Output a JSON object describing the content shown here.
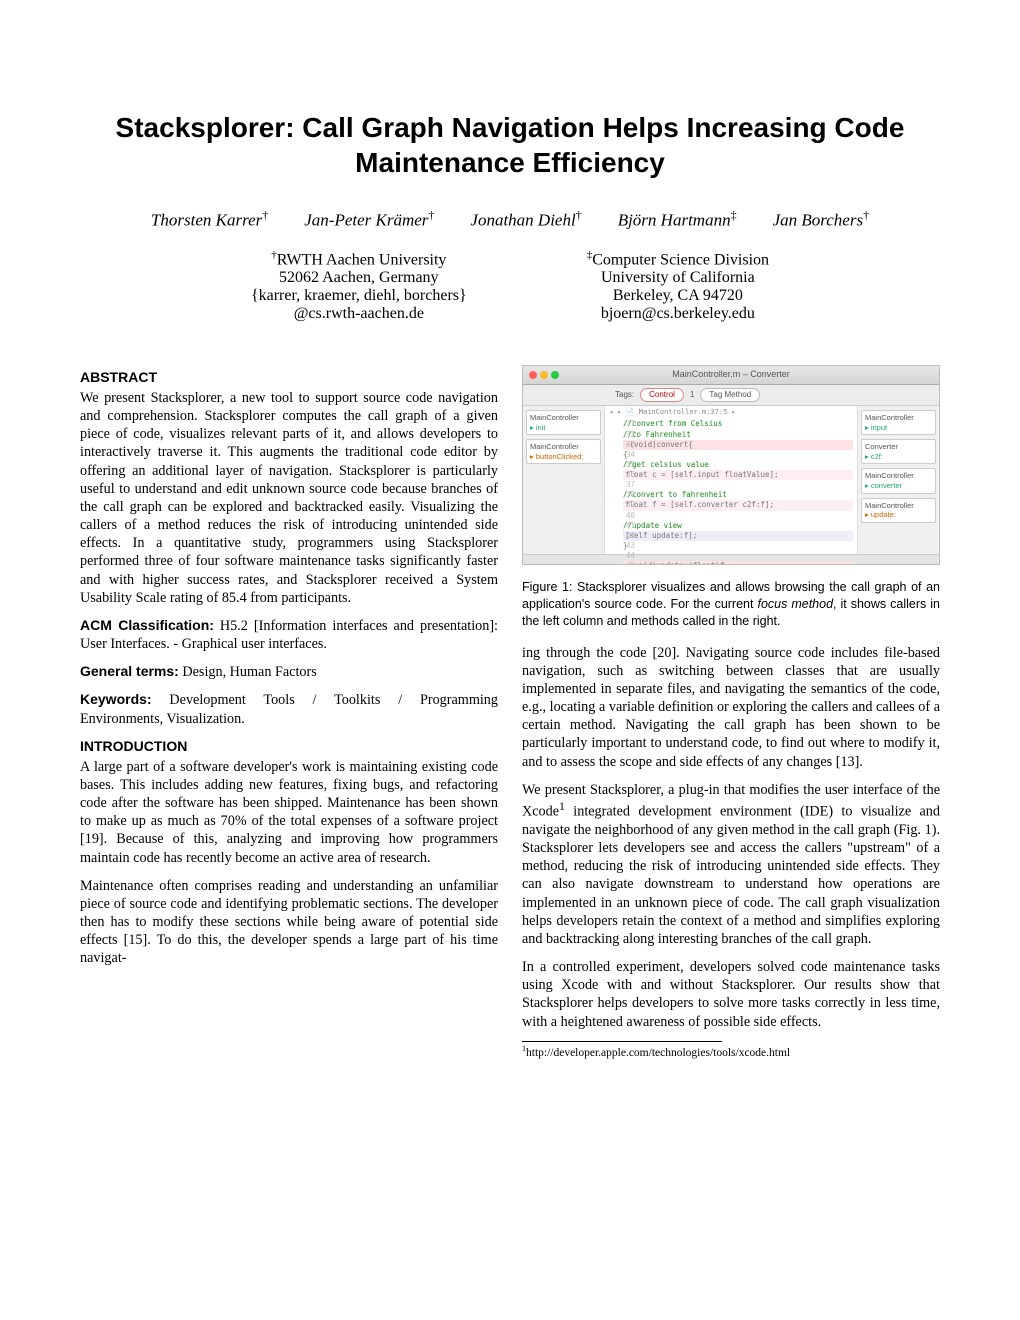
{
  "title": "Stacksplorer: Call Graph Navigation Helps Increasing Code Maintenance Efficiency",
  "authors": [
    {
      "name": "Thorsten Karrer",
      "mark": "†"
    },
    {
      "name": "Jan-Peter Krämer",
      "mark": "†"
    },
    {
      "name": "Jonathan Diehl",
      "mark": "†"
    },
    {
      "name": "Björn Hartmann",
      "mark": "‡"
    },
    {
      "name": "Jan Borchers",
      "mark": "†"
    }
  ],
  "affiliations": {
    "left": {
      "mark": "†",
      "lines": [
        "RWTH Aachen University",
        "52062 Aachen, Germany",
        "{karrer, kraemer, diehl, borchers}",
        "@cs.rwth-aachen.de"
      ]
    },
    "right": {
      "mark": "‡",
      "lines": [
        "Computer Science Division",
        "University of California",
        "Berkeley, CA 94720",
        "bjoern@cs.berkeley.edu"
      ]
    }
  },
  "left_column": {
    "abstract_head": "ABSTRACT",
    "abstract": "We present Stacksplorer, a new tool to support source code navigation and comprehension. Stacksplorer computes the call graph of a given piece of code, visualizes relevant parts of it, and allows developers to interactively traverse it. This augments the traditional code editor by offering an additional layer of navigation. Stacksplorer is particularly useful to understand and edit unknown source code because branches of the call graph can be explored and backtracked easily. Visualizing the callers of a method reduces the risk of introducing unintended side effects. In a quantitative study, programmers using Stacksplorer performed three of four software maintenance tasks significantly faster and with higher success rates, and Stacksplorer received a System Usability Scale rating of 85.4 from participants.",
    "acm_head": "ACM Classification:",
    "acm_text": " H5.2 [Information interfaces and presentation]: User Interfaces. - Graphical user interfaces.",
    "general_head": "General terms:",
    "general_text": " Design, Human Factors",
    "keywords_head": "Keywords:",
    "keywords_text": " Development Tools / Toolkits / Programming Environments, Visualization.",
    "intro_head": "INTRODUCTION",
    "intro_p1": "A large part of a software developer's work is maintaining existing code bases. This includes adding new features, fixing bugs, and refactoring code after the software has been shipped. Maintenance has been shown to make up as much as 70% of the total expenses of a software project [19]. Because of this, analyzing and improving how programmers maintain code has recently become an active area of research.",
    "intro_p2": "Maintenance often comprises reading and understanding an unfamiliar piece of source code and identifying problematic sections. The developer then has to modify these sections while being aware of potential side effects [15]. To do this, the developer spends a large part of his time navigat-"
  },
  "figure": {
    "window_title": "MainController.m – Converter",
    "tags_label": "Tags:",
    "tag_control": "Control",
    "tag_method_btn": "Tag Method",
    "path_crumb": "MainController.m:37:5",
    "left_nodes": [
      {
        "cls": "MainController",
        "meth": "init",
        "sel": false
      },
      {
        "cls": "MainController",
        "meth": "buttonClicked:",
        "sel": true
      }
    ],
    "right_nodes": [
      {
        "cls": "MainController",
        "meth": "input",
        "sel": false
      },
      {
        "cls": "Converter",
        "meth": "c2f:",
        "sel": false
      },
      {
        "cls": "MainController",
        "meth": "converter",
        "sel": false
      },
      {
        "cls": "MainController",
        "meth": "update:",
        "sel": true
      }
    ],
    "code_lines": [
      {
        "n": "31",
        "cls": "kw-green",
        "text": "//convert from Celsius"
      },
      {
        "n": "32",
        "cls": "kw-green",
        "text": "//to Fahrenheit"
      },
      {
        "n": "33",
        "cls": "hl-red",
        "text": "-(void)convert{"
      },
      {
        "n": "34",
        "cls": "",
        "text": "{"
      },
      {
        "n": "35",
        "cls": "kw-green",
        "text": "    //get celsius value"
      },
      {
        "n": "36",
        "cls": "hl-pink",
        "text": "    float c = [self.input floatValue];"
      },
      {
        "n": "37",
        "cls": "",
        "text": ""
      },
      {
        "n": "38",
        "cls": "kw-green",
        "text": "    //convert to fahrenheit"
      },
      {
        "n": "39",
        "cls": "hl-pink",
        "text": "    float f = [self.converter c2f:f];"
      },
      {
        "n": "40",
        "cls": "",
        "text": ""
      },
      {
        "n": "41",
        "cls": "kw-green",
        "text": "    //update view"
      },
      {
        "n": "42",
        "cls": "hl-purple",
        "text": "    [self update:f];"
      },
      {
        "n": "43",
        "cls": "",
        "text": "}"
      },
      {
        "n": "44",
        "cls": "",
        "text": ""
      },
      {
        "n": "45",
        "cls": "hl-red",
        "text": "-(void)update:(float)f"
      },
      {
        "n": "46",
        "cls": "",
        "text": ""
      }
    ],
    "caption_lead": "Figure 1: Stacksplorer visualizes and allows browsing the call graph of an application's source code. For the current ",
    "caption_ital": "focus method",
    "caption_tail": ", it shows callers in the left column and methods called in the right."
  },
  "right_column": {
    "p1": "ing through the code [20]. Navigating source code includes file-based navigation, such as switching between classes that are usually implemented in separate files, and navigating the semantics of the code, e.g., locating a variable definition or exploring the callers and callees of a certain method. Navigating the call graph has been shown to be particularly important to understand code, to find out where to modify it, and to assess the scope and side effects of any changes [13].",
    "p2_a": "We present Stacksplorer, a plug-in that modifies the user interface of the Xcode",
    "p2_sup": "1",
    "p2_b": " integrated development environment (IDE) to visualize and navigate the neighborhood of any given method in the call graph (Fig. 1). Stacksplorer lets developers see and access the callers \"upstream\" of a method, reducing the risk of introducing unintended side effects. They can also navigate downstream to understand how operations are implemented in an unknown piece of code. The call graph visualization helps developers retain the context of a method and simplifies exploring and backtracking along interesting branches of the call graph.",
    "p3": "In a controlled experiment, developers solved code maintenance tasks using Xcode with and without Stacksplorer. Our results show that Stacksplorer helps developers to solve more tasks correctly in less time, with a heightened awareness of possible side effects.",
    "footnote_mark": "1",
    "footnote_text": "http://developer.apple.com/technologies/tools/xcode.html"
  }
}
